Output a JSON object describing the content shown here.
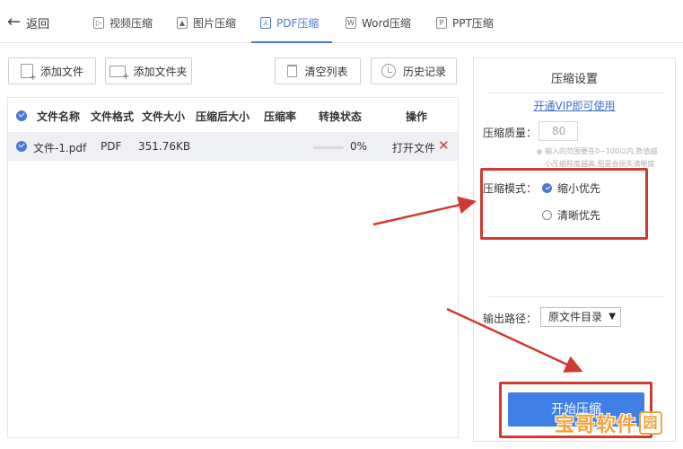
{
  "nav": {
    "back_label": "返回",
    "tabs": [
      {
        "label": "视频压缩",
        "icon": "video-file-icon",
        "active": false
      },
      {
        "label": "图片压缩",
        "icon": "image-file-icon",
        "active": false
      },
      {
        "label": "PDF压缩",
        "icon": "pdf-file-icon",
        "active": true
      },
      {
        "label": "Word压缩",
        "icon": "word-file-icon",
        "active": false
      },
      {
        "label": "PPT压缩",
        "icon": "ppt-file-icon",
        "active": false
      }
    ]
  },
  "toolbar": {
    "add_file": "添加文件",
    "add_folder": "添加文件夹",
    "clear_list": "清空列表",
    "history": "历史记录"
  },
  "table": {
    "columns": [
      "文件名称",
      "文件格式",
      "文件大小",
      "压缩后大小",
      "压缩率",
      "转换状态",
      "操作"
    ],
    "rows": [
      {
        "name": "文件-1.pdf",
        "format": "PDF",
        "size": "351.76KB",
        "compressed_size": "",
        "ratio": "",
        "progress": "0%",
        "progress_value": 0,
        "action": "打开文件"
      }
    ]
  },
  "settings": {
    "title": "压缩设置",
    "vip_link": "开通VIP即可使用",
    "quality_label": "压缩质量：",
    "quality_value": "80",
    "quality_hint_1": "输入的范围要在0~100以内,数值越",
    "quality_hint_2": "小压缩程度越高,但是会损失清晰度",
    "mode_label": "压缩模式：",
    "modes": [
      {
        "label": "缩小优先",
        "selected": true
      },
      {
        "label": "清晰优先",
        "selected": false
      }
    ],
    "output_label": "输出路径：",
    "output_value": "原文件目录",
    "start_button": "开始压缩"
  },
  "watermark": {
    "text": "宝哥软件",
    "seal": "园"
  },
  "colors": {
    "accent": "#4a78d8",
    "button_blue": "#3f7fe6",
    "annotation_red": "#d03a33",
    "watermark_orange": "#f3a43a"
  }
}
